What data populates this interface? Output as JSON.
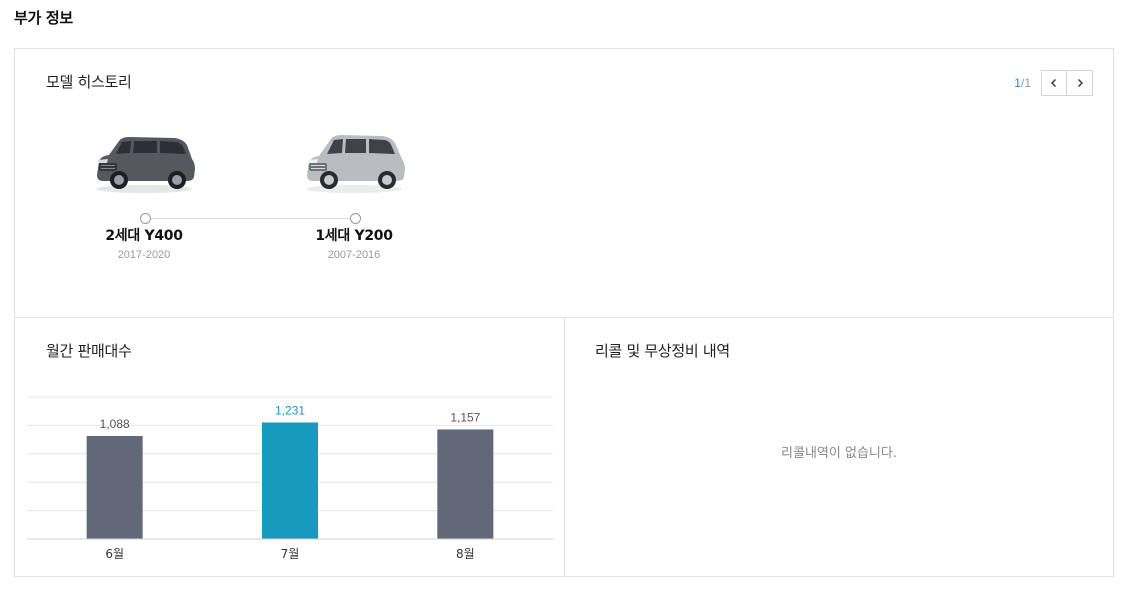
{
  "section_title": "부가 정보",
  "model_history": {
    "heading": "모델 히스토리",
    "pager": {
      "current": "1",
      "total": "/1"
    },
    "models": [
      {
        "name": "2세대 Y400",
        "years": "2017-2020",
        "color": "#55585f"
      },
      {
        "name": "1세대 Y200",
        "years": "2007-2016",
        "color": "#b9bcc0"
      }
    ]
  },
  "monthly_sales": {
    "heading": "월간 판매대수"
  },
  "recall": {
    "heading": "리콜 및 무상정비 내역",
    "empty_message": "리콜내역이 없습니다."
  },
  "chart_data": {
    "type": "bar",
    "categories": [
      "6월",
      "7월",
      "8월"
    ],
    "values": [
      1088,
      1231,
      1157
    ],
    "value_labels": [
      "1,088",
      "1,231",
      "1,157"
    ],
    "highlight_index": 1,
    "colors": {
      "default": "#636879",
      "highlight": "#169bbd",
      "label_default": "#555555",
      "label_highlight": "#169bbd"
    },
    "grid": true,
    "ylim": [
      0,
      1500
    ],
    "title": "",
    "xlabel": "",
    "ylabel": ""
  }
}
